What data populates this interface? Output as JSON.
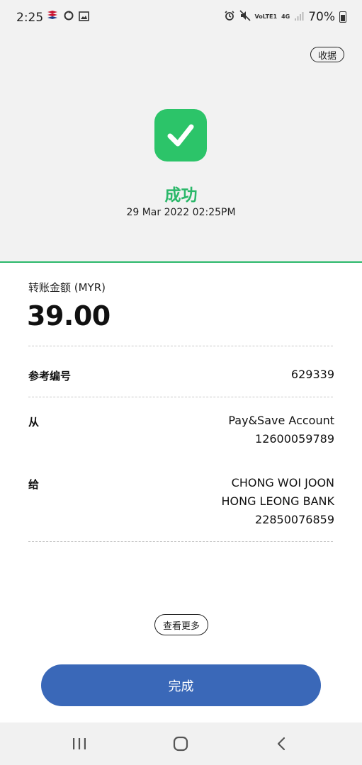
{
  "status_bar": {
    "time": "2:25",
    "battery_percent": "70%",
    "network_labels": [
      "VoLTE1",
      "4G"
    ]
  },
  "header": {
    "receipt_button": "收据",
    "status_title": "成功",
    "datetime": "29 Mar 2022 02:25PM"
  },
  "amount": {
    "label": "转账金额 (MYR)",
    "value": "39.00"
  },
  "details": {
    "reference_label": "参考编号",
    "reference_value": "629339",
    "from_label": "从",
    "from_account_name": "Pay&Save Account",
    "from_account_number": "12600059789",
    "to_label": "给",
    "to_name": "CHONG WOI JOON",
    "to_bank": "HONG LEONG BANK",
    "to_account_number": "22850076859"
  },
  "actions": {
    "view_more": "查看更多",
    "done": "完成"
  },
  "colors": {
    "success_green": "#2cc469",
    "primary_blue": "#3a68b8"
  },
  "icons": {
    "success": "check-icon",
    "nav_recent": "recent-apps-icon",
    "nav_home": "home-icon",
    "nav_back": "back-icon"
  }
}
